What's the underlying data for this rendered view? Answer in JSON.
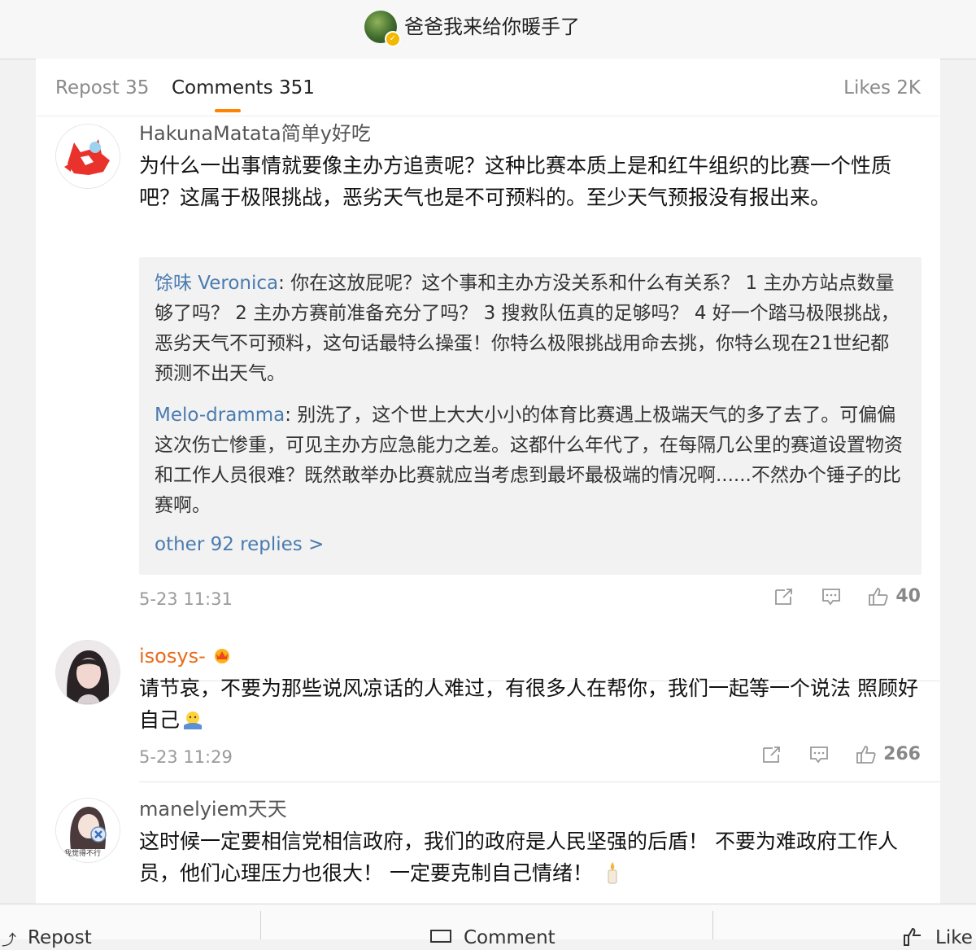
{
  "header": {
    "title": "爸爸我来给你暖手了"
  },
  "tabs": {
    "repost": "Repost 35",
    "comments": "Comments 351",
    "likes": "Likes 2K"
  },
  "comments": [
    {
      "user": "HakunaMatata简单y好吃",
      "text": "为什么一出事情就要像主办方追责呢？这种比赛本质上是和红牛组织的比赛一个性质吧？这属于极限挑战，恶劣天气也是不可预料的。至少天气预报没有报出来。",
      "replies": [
        {
          "name": "馀味 Veronica",
          "text": ": 你在这放屁呢？这个事和主办方没关系和什么有关系？ 1 主办方站点数量够了吗？ 2 主办方赛前准备充分了吗？ 3 搜救队伍真的足够吗？ 4 好一个踏马极限挑战，恶劣天气不可预料，这句话最特么操蛋！你特么极限挑战用命去挑，你特么现在21世纪都预测不出天气。"
        },
        {
          "name": "Melo-dramma",
          "text": ": 别洗了，这个世上大大小小的体育比赛遇上极端天气的多了去了。可偏偏这次伤亡惨重，可见主办方应急能力之差。这都什么年代了，在每隔几公里的赛道设置物资和工作人员很难？既然敢举办比赛就应当考虑到最坏最极端的情况啊......不然办个锤子的比赛啊。"
        }
      ],
      "more_replies": "other 92 replies >",
      "time": "5-23 11:31",
      "likes": "40"
    },
    {
      "user": "isosys-",
      "text": "请节哀，不要为那些说风凉话的人难过，有很多人在帮你，我们一起等一个说法 照顾好自己",
      "time": "5-23 11:29",
      "likes": "266"
    },
    {
      "user": "manelyiem天天",
      "text": "这时候一定要相信党相信政府，我们的政府是人民坚强的后盾！ 不要为难政府工作人员，他们心理压力也很大！ 一定要克制自己情绪！",
      "avatar_caption": "我觉得不行"
    }
  ],
  "bottom_bar": {
    "repost": "Repost",
    "comment": "Comment",
    "like": "Like"
  },
  "colors": {
    "accent_orange": "#ff8200",
    "link_blue": "#4a7bb0",
    "vip_name_orange": "#e86b1c"
  },
  "icons": [
    "verified-badge-icon",
    "repost-icon",
    "comment-icon",
    "thumbs-up-icon",
    "vip-crown-icon",
    "shrug-emoji-icon",
    "candle-emoji-icon"
  ]
}
